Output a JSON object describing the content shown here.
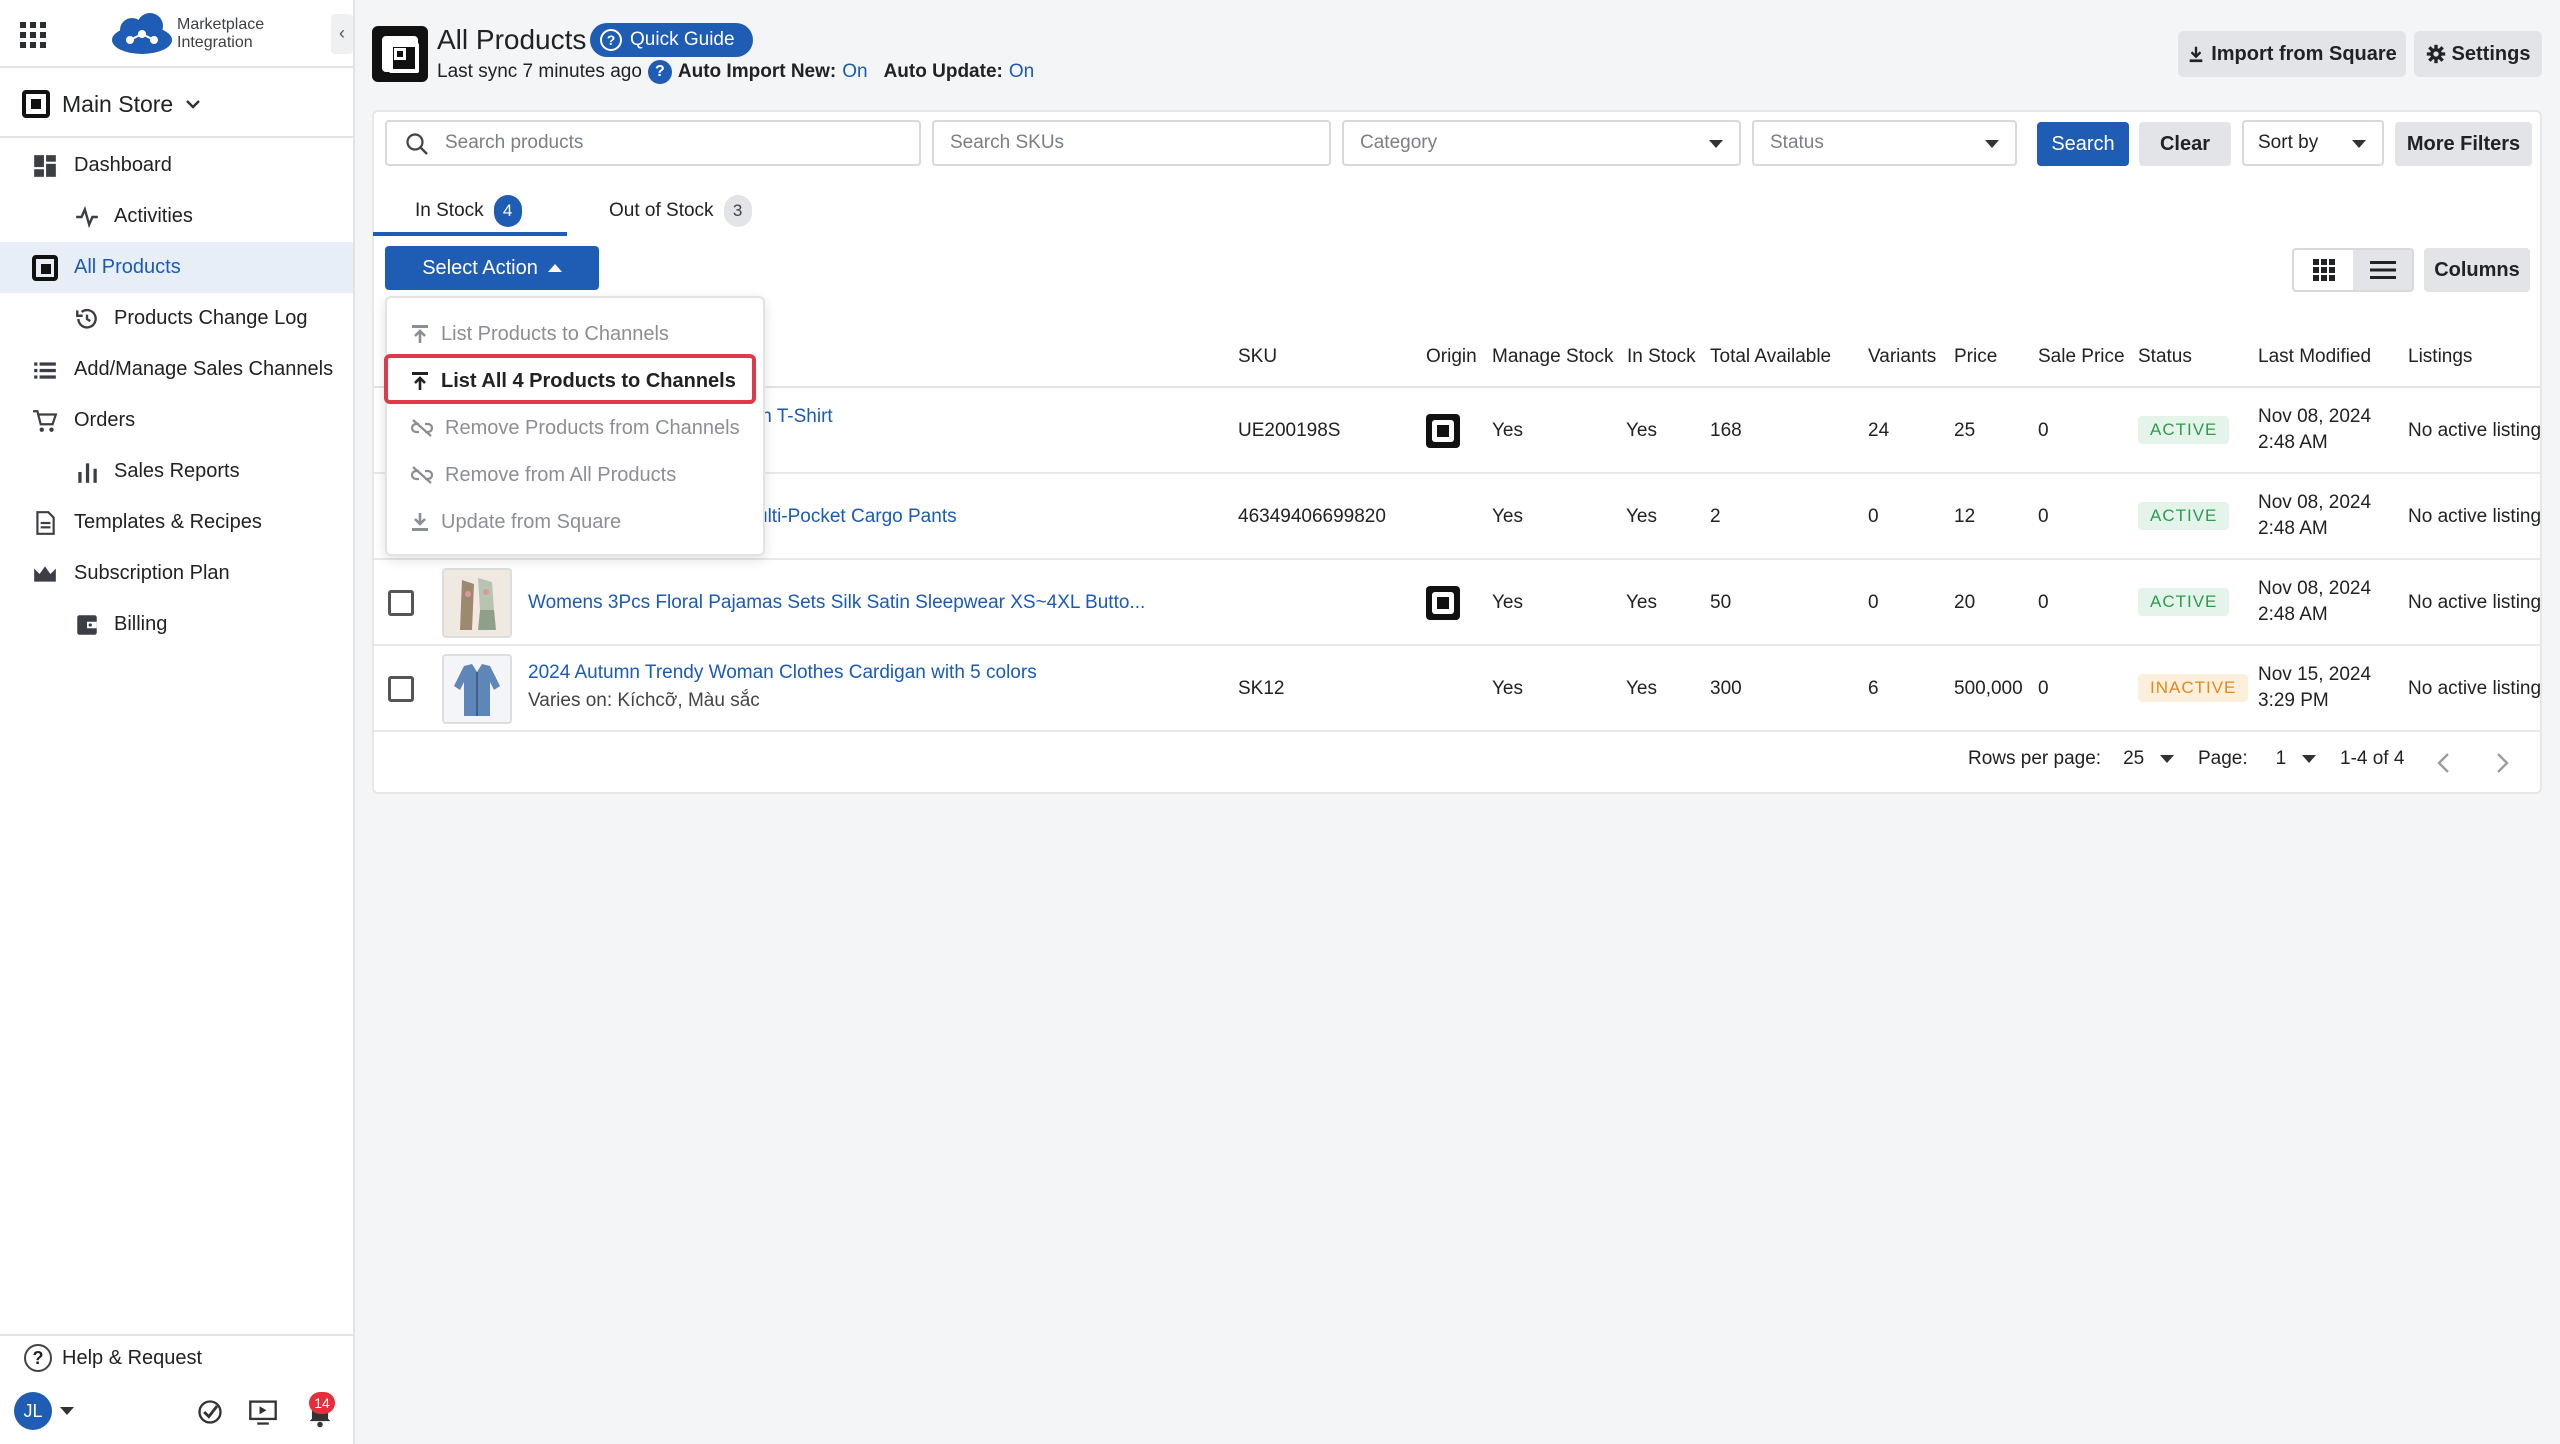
{
  "app": {
    "name_line1": "Marketplace",
    "name_line2": "Integration"
  },
  "store": {
    "name": "Main Store"
  },
  "nav": {
    "dashboard": "Dashboard",
    "activities": "Activities",
    "all_products": "All Products",
    "products_change_log": "Products Change Log",
    "add_manage_channels": "Add/Manage Sales Channels",
    "orders": "Orders",
    "sales_reports": "Sales Reports",
    "templates": "Templates & Recipes",
    "subscription": "Subscription Plan",
    "billing": "Billing"
  },
  "footer": {
    "help": "Help & Request",
    "avatar_initials": "JL",
    "notification_count": "14"
  },
  "header": {
    "title": "All Products",
    "quick_guide": "Quick Guide",
    "last_sync": "Last sync 7 minutes ago",
    "auto_import_label": "Auto Import New:",
    "auto_import_value": "On",
    "auto_update_label": "Auto Update:",
    "auto_update_value": "On",
    "import_button": "Import from Square",
    "settings_button": "Settings"
  },
  "filters": {
    "search_products_placeholder": "Search products",
    "search_skus_placeholder": "Search SKUs",
    "category": "Category",
    "status": "Status",
    "search_button": "Search",
    "clear_button": "Clear",
    "sort_by": "Sort by",
    "more_filters": "More Filters"
  },
  "tabs": [
    {
      "label": "In Stock",
      "count": "4"
    },
    {
      "label": "Out of Stock",
      "count": "3"
    }
  ],
  "toolbar": {
    "select_action": "Select Action",
    "columns": "Columns"
  },
  "action_menu": [
    {
      "label": "List Products to Channels",
      "enabled": false
    },
    {
      "label": "List All 4 Products to Channels",
      "enabled": true
    },
    {
      "label": "Remove Products from Channels",
      "enabled": false
    },
    {
      "label": "Remove from All Products",
      "enabled": false
    },
    {
      "label": "Update from Square",
      "enabled": false
    }
  ],
  "table": {
    "columns": [
      "SKU",
      "Origin",
      "Manage Stock",
      "In Stock",
      "Total Available",
      "Variants",
      "Price",
      "Sale Price",
      "Status",
      "Last Modified",
      "Listings"
    ],
    "rows": [
      {
        "name": "in T-Shirt",
        "sub": "",
        "sku": "UE200198S",
        "origin": true,
        "manage_stock": "Yes",
        "in_stock": "Yes",
        "total": "168",
        "variants": "24",
        "price": "25",
        "sale_price": "0",
        "status": "ACTIVE",
        "date": "Nov 08, 2024",
        "time": "2:48 AM",
        "listings": "No active listing"
      },
      {
        "name": "ulti-Pocket Cargo Pants",
        "sub": "",
        "sku": "46349406699820",
        "origin": false,
        "manage_stock": "Yes",
        "in_stock": "Yes",
        "total": "2",
        "variants": "0",
        "price": "12",
        "sale_price": "0",
        "status": "ACTIVE",
        "date": "Nov 08, 2024",
        "time": "2:48 AM",
        "listings": "No active listing"
      },
      {
        "name": "Womens 3Pcs Floral Pajamas Sets Silk Satin Sleepwear XS~4XL Butto...",
        "sub": "",
        "sku": "",
        "origin": true,
        "manage_stock": "Yes",
        "in_stock": "Yes",
        "total": "50",
        "variants": "0",
        "price": "20",
        "sale_price": "0",
        "status": "ACTIVE",
        "date": "Nov 08, 2024",
        "time": "2:48 AM",
        "listings": "No active listing"
      },
      {
        "name": "2024 Autumn Trendy Woman Clothes Cardigan with 5 colors",
        "sub": "Varies on: Kíchcỡ, Màu sắc",
        "sku": "SK12",
        "origin": false,
        "manage_stock": "Yes",
        "in_stock": "Yes",
        "total": "300",
        "variants": "6",
        "price": "500,000",
        "sale_price": "0",
        "status": "INACTIVE",
        "date": "Nov 15, 2024",
        "time": "3:29 PM",
        "listings": "No active listing"
      }
    ]
  },
  "pagination": {
    "rows_per_page_label": "Rows per page:",
    "rows_per_page": "25",
    "page_label": "Page:",
    "page": "1",
    "range": "1-4 of 4"
  },
  "colors": {
    "accent": "#1f5cb3",
    "active": "#2f9a4e",
    "inactive": "#e38a1a",
    "highlight": "#e03a4a"
  }
}
